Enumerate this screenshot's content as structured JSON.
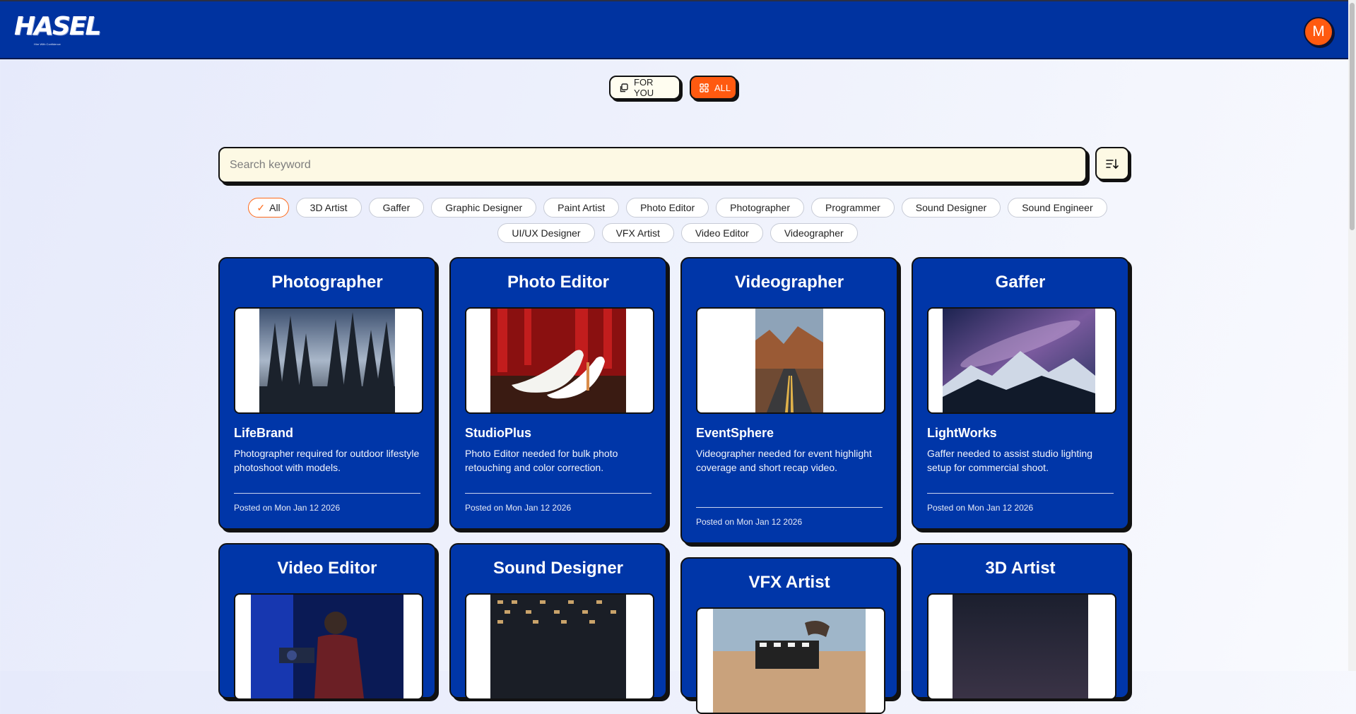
{
  "header": {
    "logo": "HASEL",
    "tagline": "Hire With Confidence",
    "avatar_initial": "M"
  },
  "mode_toggle": {
    "for_you_label": "FOR YOU",
    "all_label": "ALL",
    "active": "ALL"
  },
  "search": {
    "placeholder": "Search keyword",
    "value": ""
  },
  "categories": [
    "All",
    "3D Artist",
    "Gaffer",
    "Graphic Designer",
    "Paint Artist",
    "Photo Editor",
    "Photographer",
    "Programmer",
    "Sound Designer",
    "Sound Engineer",
    "UI/UX Designer",
    "VFX Artist",
    "Video Editor",
    "Videographer"
  ],
  "selected_category": "All",
  "jobs": [
    {
      "role": "Photographer",
      "company": "LifeBrand",
      "description": "Photographer required for outdoor lifestyle photoshoot with models.",
      "posted": "Posted on Mon Jan 12 2026",
      "image": "forest-photo"
    },
    {
      "role": "Photo Editor",
      "company": "StudioPlus",
      "description": "Photo Editor needed for bulk photo retouching and color correction.",
      "posted": "Posted on Mon Jan 12 2026",
      "image": "white-heels-photo"
    },
    {
      "role": "Videographer",
      "company": "EventSphere",
      "description": "Videographer needed for event highlight coverage and short recap video.",
      "posted": "Posted on Mon Jan 12 2026",
      "image": "desert-road-photo"
    },
    {
      "role": "Gaffer",
      "company": "LightWorks",
      "description": "Gaffer needed to assist studio lighting setup for commercial shoot.",
      "posted": "Posted on Mon Jan 12 2026",
      "image": "milky-way-mountains-photo"
    },
    {
      "role": "Video Editor",
      "image": "camera-operator-photo"
    },
    {
      "role": "Sound Designer",
      "image": "night-building-photo"
    },
    {
      "role": "VFX Artist",
      "image": "clapperboard-photo"
    },
    {
      "role": "3D Artist",
      "image": "night-sky-photo"
    }
  ]
}
